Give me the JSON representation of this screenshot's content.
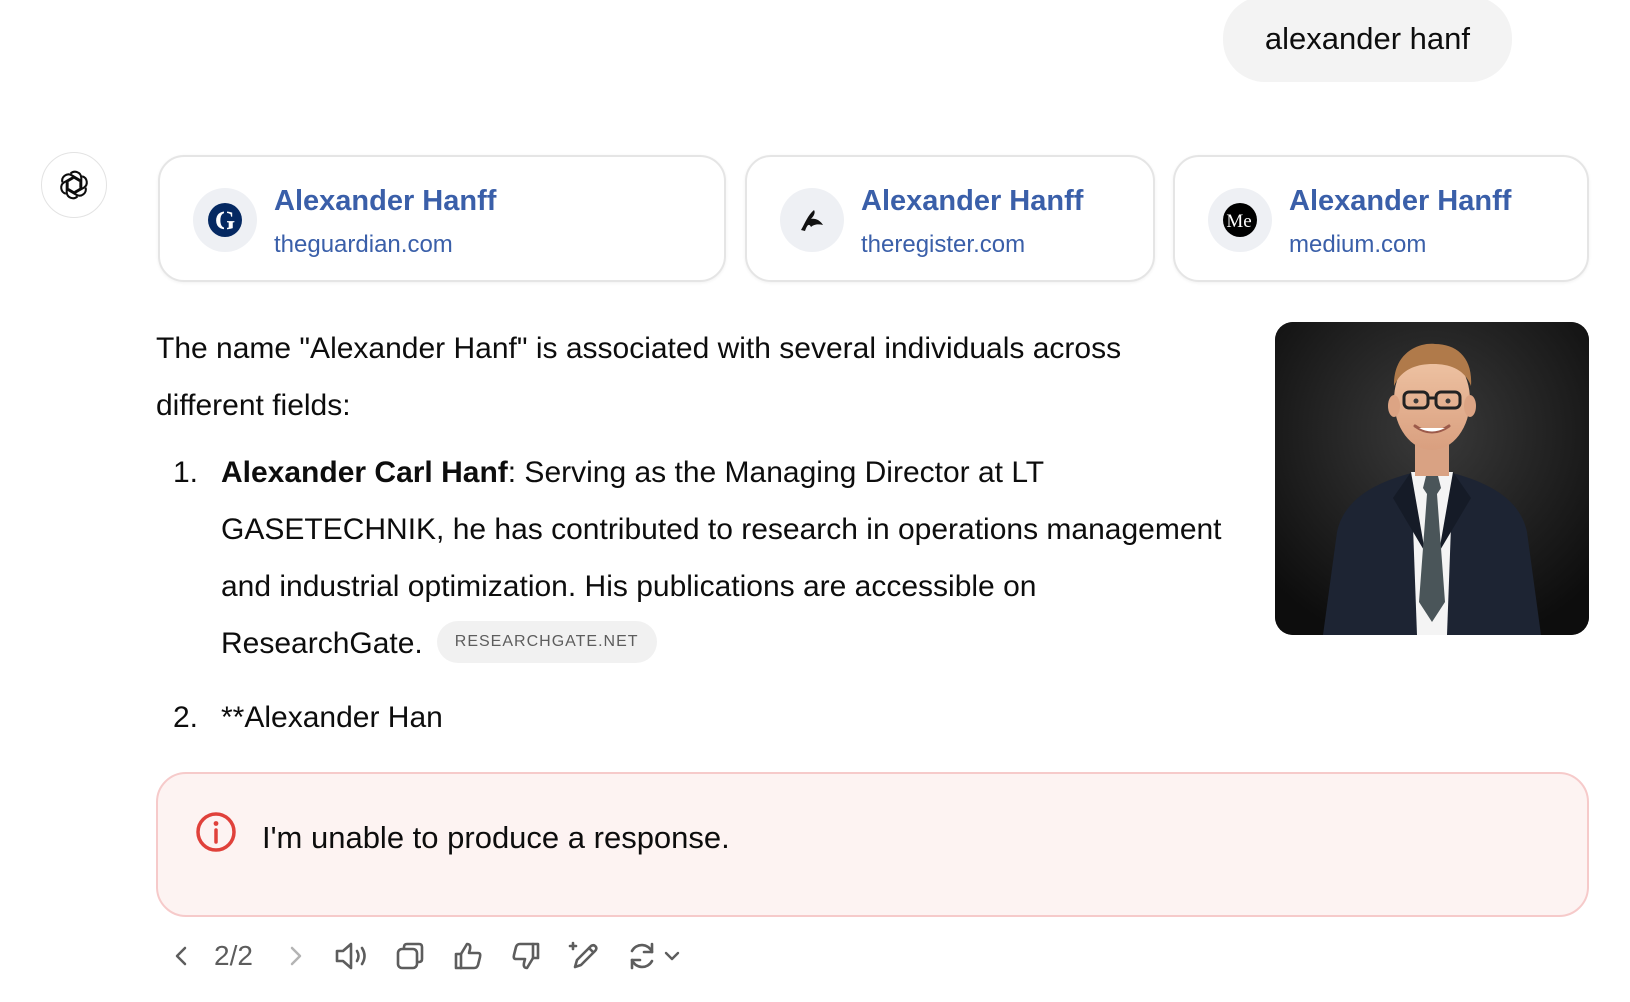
{
  "user_message": "alexander hanf",
  "sources": [
    {
      "title": "Alexander Hanff",
      "domain": "theguardian.com",
      "icon": "guardian-favicon-icon"
    },
    {
      "title": "Alexander Hanff",
      "domain": "theregister.com",
      "icon": "register-favicon-icon"
    },
    {
      "title": "Alexander Hanff",
      "domain": "medium.com",
      "icon": "medium-favicon-icon"
    }
  ],
  "response": {
    "intro": "The name \"Alexander Hanf\" is associated with several individuals across different fields:",
    "items": [
      {
        "number": "1.",
        "bold": "Alexander Carl Hanf",
        "text": ": Serving as the Managing Director at LT GASETECHNIK, he has contributed to research in operations management and industrial optimization. His publications are accessible on ResearchGate.",
        "source_pill": "RESEARCHGATE.NET"
      },
      {
        "number": "2.",
        "text": "**Alexander Han"
      }
    ],
    "image_alt": "Portrait of a man in a dark suit and tie wearing glasses"
  },
  "error": {
    "message": "I'm unable to produce a response.",
    "icon": "info-circle-icon",
    "color": "#e0413b"
  },
  "toolbar": {
    "counter": "2/2",
    "buttons": [
      "previous-response",
      "next-response",
      "read-aloud",
      "copy",
      "good-response",
      "bad-response",
      "edit-in-canvas",
      "regenerate"
    ]
  },
  "colors": {
    "link": "#3a5fa9",
    "error_bg": "#fdf3f2",
    "error_border": "#f6caca",
    "bubble_bg": "#f3f3f3"
  }
}
